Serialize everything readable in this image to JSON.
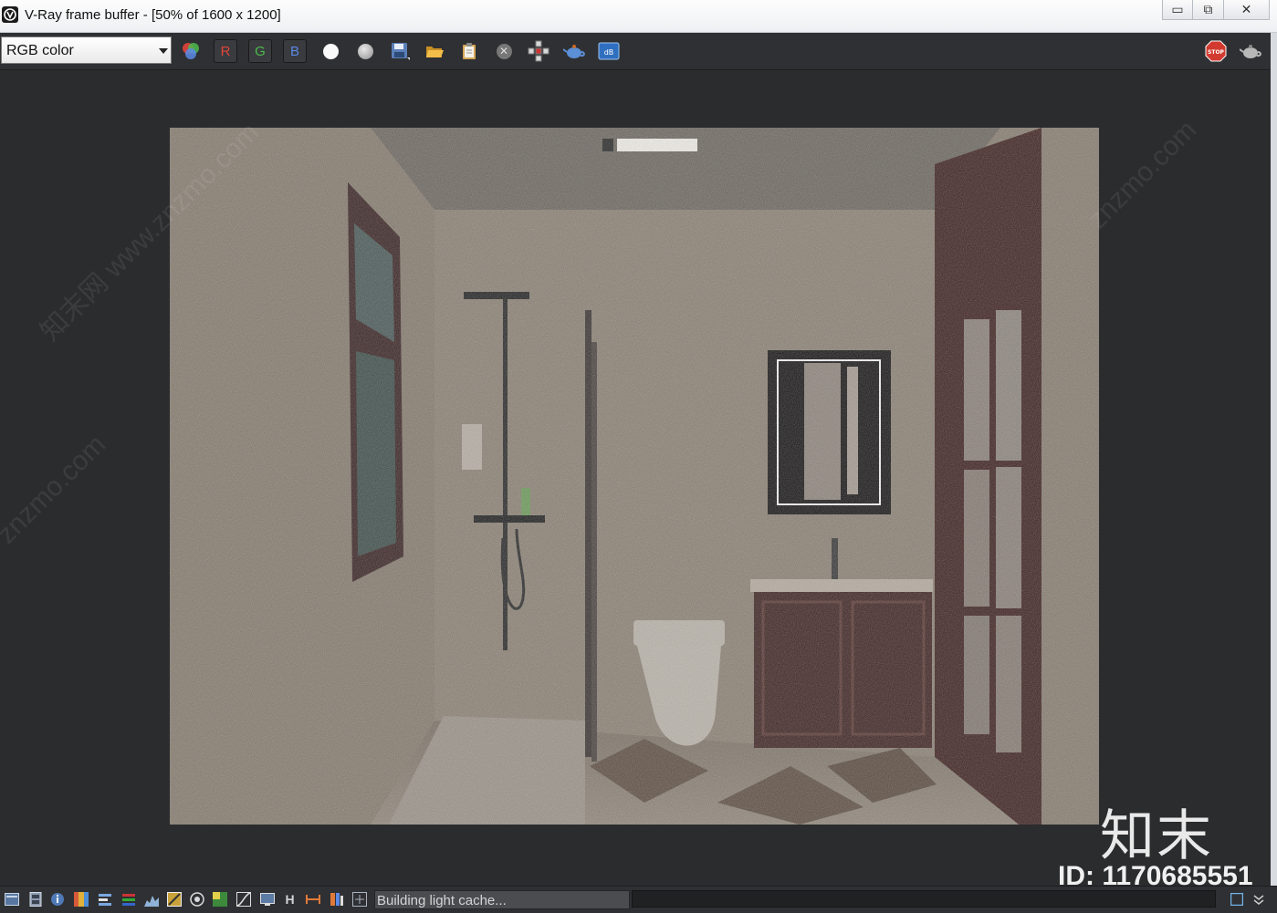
{
  "window": {
    "title": "V-Ray frame buffer - [50% of 1600 x 1200]",
    "minimize_glyph": "▭",
    "restore_glyph": "⧉",
    "close_glyph": "✕"
  },
  "toolbar": {
    "channel_value": "RGB color",
    "r_label": "R",
    "g_label": "G",
    "b_label": "B",
    "r_color": "#e0453a",
    "g_color": "#4dbb4d",
    "b_color": "#5a8ae6",
    "stop_label": "STOP"
  },
  "status": {
    "message": "Building light cache...",
    "progress_fraction": 0.0,
    "h_label": "H"
  },
  "watermark": {
    "site": "知末网 www.znzmo.com",
    "site_short": "znzmo.com",
    "brand": "知末",
    "id": "ID: 1170685551"
  },
  "colors": {
    "background": "#2b2c2e",
    "toolbar": "#2f3033",
    "wall": "#8c8274",
    "wood": "#3f2321"
  }
}
